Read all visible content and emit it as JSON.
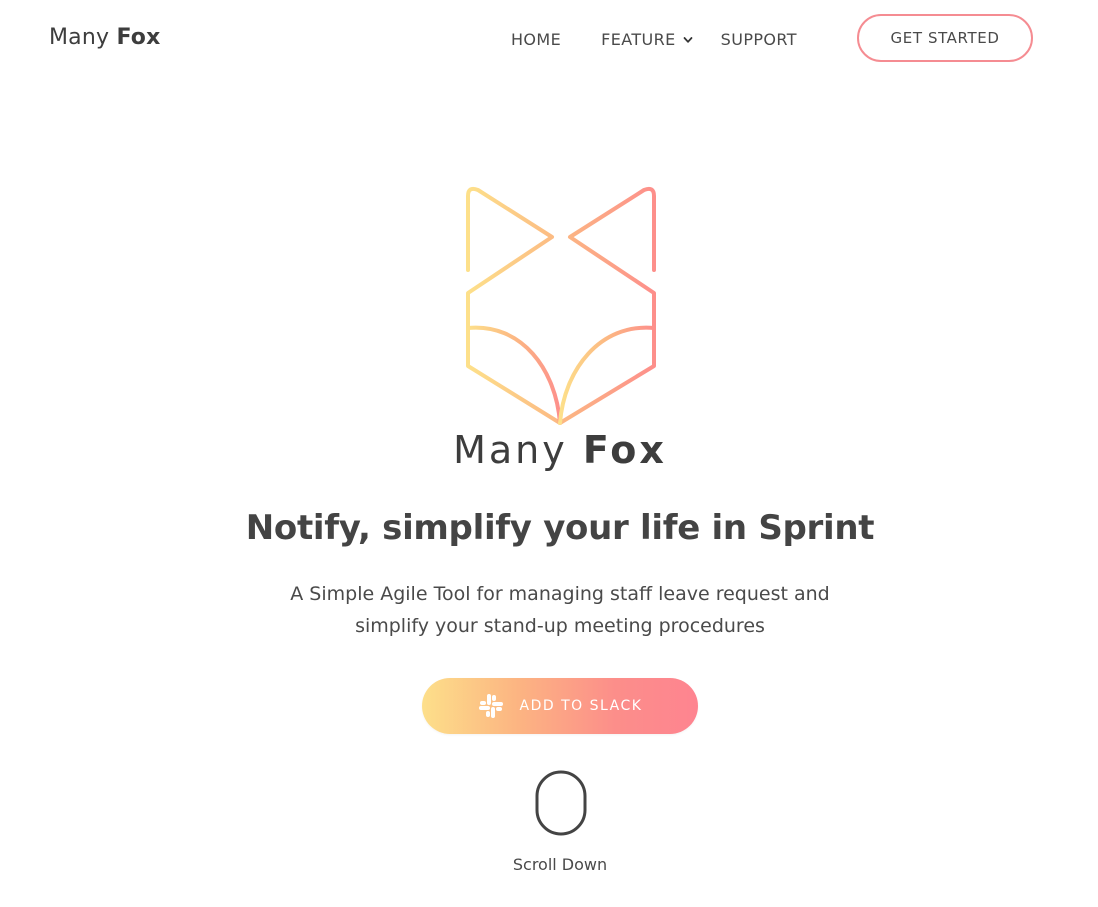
{
  "brand": {
    "name_light": "Many",
    "name_bold": "Fox"
  },
  "nav": {
    "home": "HOME",
    "feature": "FEATURE",
    "support": "SUPPORT",
    "cta": "GET STARTED"
  },
  "hero": {
    "logo_word_light": "Many",
    "logo_word_bold": "Fox",
    "headline": "Notify, simplify your life in Sprint",
    "subtext_line1": "A Simple Agile Tool for managing staff leave request and",
    "subtext_line2": "simplify your stand-up meeting procedures",
    "slack_button": "ADD TO SLACK",
    "scroll_label": "Scroll Down"
  },
  "icons": {
    "dropdown": "chevron-down-icon",
    "slack": "slack-icon",
    "scroll": "mouse-icon",
    "logo": "fox-logo-icon"
  },
  "colors": {
    "gradient_start": "#fde08a",
    "gradient_end": "#fd8690",
    "cta_border": "#f58c92",
    "text": "#444444"
  }
}
